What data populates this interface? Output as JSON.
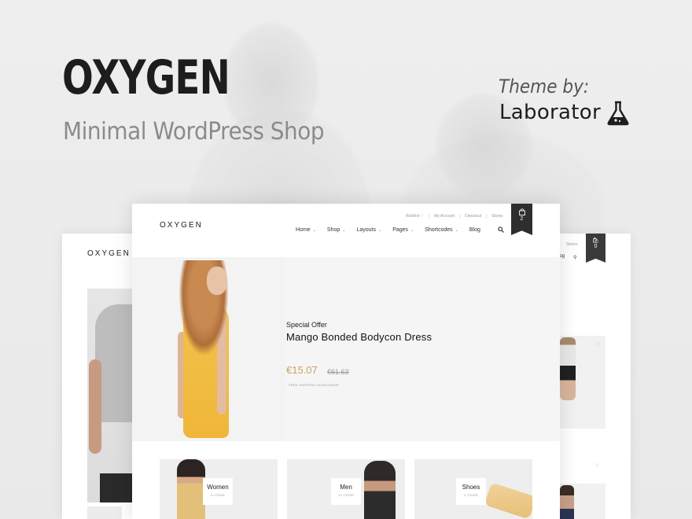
{
  "brand": {
    "title": "OXYGEN",
    "subtitle": "Minimal WordPress Shop",
    "theme_by": "Theme by:",
    "author": "Laborator",
    "author_icon": "flask-icon"
  },
  "main_site": {
    "logo": "OXYGEN",
    "top_links": [
      "Wishlist ♡",
      "My Account",
      "Checkout",
      "Stores"
    ],
    "nav": [
      {
        "label": "Home",
        "has_dropdown": true
      },
      {
        "label": "Shop",
        "has_dropdown": true
      },
      {
        "label": "Layouts",
        "has_dropdown": true
      },
      {
        "label": "Pages",
        "has_dropdown": true
      },
      {
        "label": "Shortcodes",
        "has_dropdown": true
      },
      {
        "label": "Blog",
        "has_dropdown": false
      }
    ],
    "cart_count": "2",
    "hero": {
      "label": "Special Offer",
      "title": "Mango Bonded Bodycon Dress",
      "price": "€15.07",
      "old_price": "€61.63",
      "note": "FREE SHIPPING WORLDWIDE"
    },
    "categories": [
      {
        "name": "Women",
        "count": "8 ITEMS"
      },
      {
        "name": "Men",
        "count": "11 ITEMS"
      },
      {
        "name": "Shoes",
        "count": "3 ITEMS"
      }
    ]
  },
  "left_site": {
    "logo": "OXYGEN"
  },
  "right_site": {
    "stores": "Stores",
    "blog": "log",
    "cart_count": "0"
  },
  "colors": {
    "accent_price": "#c8a262",
    "cart_badge": "#2e2e2e",
    "dress": "#f2c34a"
  }
}
